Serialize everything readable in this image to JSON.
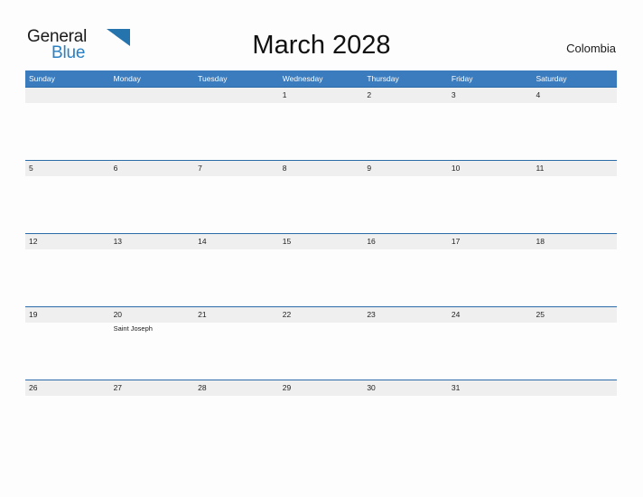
{
  "brand": {
    "line1": "General",
    "line2": "Blue",
    "flag_icon": "blue-triangle-flag-icon",
    "flag_color": "#2574ae"
  },
  "header": {
    "title": "March 2028",
    "country": "Colombia"
  },
  "colors": {
    "header_blue": "#3a7cbe",
    "row_rule_blue": "#2a6ba8",
    "band_gray": "#efefef",
    "brand_blue": "#2980c4",
    "page_background": "#fdfdfd"
  },
  "calendar": {
    "weekdays": [
      "Sunday",
      "Monday",
      "Tuesday",
      "Wednesday",
      "Thursday",
      "Friday",
      "Saturday"
    ],
    "weeks": [
      [
        {
          "day": ""
        },
        {
          "day": ""
        },
        {
          "day": ""
        },
        {
          "day": "1"
        },
        {
          "day": "2"
        },
        {
          "day": "3"
        },
        {
          "day": "4"
        }
      ],
      [
        {
          "day": "5"
        },
        {
          "day": "6"
        },
        {
          "day": "7"
        },
        {
          "day": "8"
        },
        {
          "day": "9"
        },
        {
          "day": "10"
        },
        {
          "day": "11"
        }
      ],
      [
        {
          "day": "12"
        },
        {
          "day": "13"
        },
        {
          "day": "14"
        },
        {
          "day": "15"
        },
        {
          "day": "16"
        },
        {
          "day": "17"
        },
        {
          "day": "18"
        }
      ],
      [
        {
          "day": "19"
        },
        {
          "day": "20",
          "event": "Saint Joseph"
        },
        {
          "day": "21"
        },
        {
          "day": "22"
        },
        {
          "day": "23"
        },
        {
          "day": "24"
        },
        {
          "day": "25"
        }
      ],
      [
        {
          "day": "26"
        },
        {
          "day": "27"
        },
        {
          "day": "28"
        },
        {
          "day": "29"
        },
        {
          "day": "30"
        },
        {
          "day": "31"
        },
        {
          "day": ""
        }
      ]
    ]
  }
}
